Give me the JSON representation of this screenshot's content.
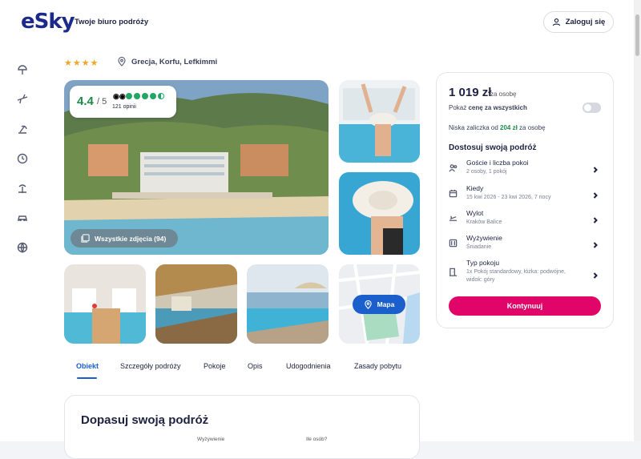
{
  "header": {
    "logo_text": "eSky",
    "tagline": "Twoje biuro podróży",
    "login_label": "Zaloguj się"
  },
  "sidebar": {
    "icons": [
      "beach-umbrella-icon",
      "plane-icon",
      "beach-icon",
      "clock-icon",
      "palm-icon",
      "car-icon",
      "globe-icon"
    ]
  },
  "hotel": {
    "stars": "★★★★",
    "location": "Grecja, Korfu, Lefkimmi"
  },
  "rating": {
    "score": "4.4",
    "max": "/ 5",
    "opinions": "121 opinii",
    "tripadvisor_dots": 4.5
  },
  "gallery": {
    "all_photos_label": "Wszystkie zdjęcia (94)",
    "map_label": "Mapa"
  },
  "tabs": [
    "Obiekt",
    "Szczegóły podróży",
    "Pokoje",
    "Opis",
    "Udogodnienia",
    "Zasady pobytu"
  ],
  "fit": {
    "title": "Dopasuj swoją podróż",
    "field1_label": "Wyżywienie",
    "field2_label": "Ile osób?"
  },
  "booking": {
    "price": "1 019 zł",
    "per_person": "za osobę",
    "show_price_prefix": "Pokaż ",
    "show_price_bold": "cenę za wszystkich",
    "deposit_prefix": "Niska zaliczka od ",
    "deposit_amount": "204 zł",
    "deposit_suffix": " za osobę",
    "customize_title": "Dostosuj swoją podróż",
    "options": [
      {
        "title": "Goście i liczba pokoi",
        "sub": "2 osoby, 1 pokój",
        "icon": "users-icon"
      },
      {
        "title": "Kiedy",
        "sub": "15 kwi 2026 - 23 kwi 2026, 7 nocy",
        "icon": "calendar-icon"
      },
      {
        "title": "Wylot",
        "sub": "Kraków Balice",
        "icon": "plane-icon"
      },
      {
        "title": "Wyżywienie",
        "sub": "Śniadanie",
        "icon": "meal-icon"
      },
      {
        "title": "Typ pokoju",
        "sub": "1x Pokój standardowy, łóżka: podwójne, widok: góry",
        "icon": "door-icon"
      }
    ],
    "cta_label": "Kontynuuj"
  },
  "colors": {
    "accent_blue": "#1a5fcc",
    "cta_pink": "#e1056a",
    "rating_green": "#1e8a4a",
    "star_gold": "#f5a623"
  }
}
